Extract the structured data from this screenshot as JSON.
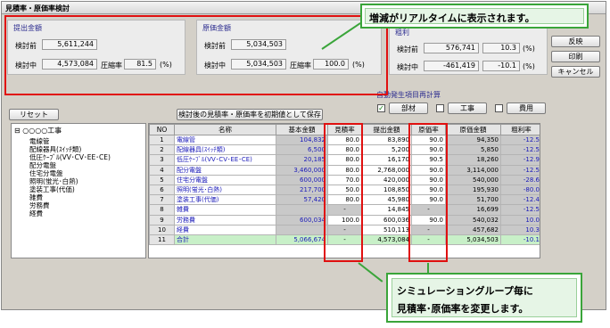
{
  "window": {
    "title": "見積率・原価率検討"
  },
  "submit_group": {
    "title": "提出金額",
    "before_label": "検討前",
    "before_value": "5,611,244",
    "during_label": "検討中",
    "during_value": "4,573,084",
    "ratio_label": "圧縮率",
    "ratio_value": "81.5",
    "unit": "(%)"
  },
  "cost_group": {
    "title": "原価金額",
    "before_label": "検討前",
    "before_value": "5,034,503",
    "during_label": "検討中",
    "during_value": "5,034,503",
    "ratio_label": "圧縮率",
    "ratio_value": "100.0",
    "unit": "(%)"
  },
  "profit_group": {
    "title": "粗利",
    "before_label": "検討前",
    "before_value": "576,741",
    "before_pct": "10.3",
    "during_label": "検討中",
    "during_value": "-461,419",
    "during_pct": "-10.1",
    "unit": "(%)"
  },
  "buttons": {
    "apply": "反映",
    "print": "印刷",
    "cancel": "キャンセル",
    "reset": "リセット",
    "save_initial": "検討後の見積率・原価率を初期値として保存"
  },
  "recalc": {
    "title": "自動発生項目再計算",
    "options": [
      {
        "label": "部材",
        "checked": true
      },
      {
        "label": "工事",
        "checked": false
      },
      {
        "label": "費用",
        "checked": false
      }
    ]
  },
  "tree": {
    "root": "○○○○工事",
    "nodes": [
      "電線管",
      "配線器具(ｽｲｯﾁ類)",
      "低圧ｹｰﾌﾞﾙ(VV･CV･EE･CE)",
      "配分電盤",
      "住宅分電盤",
      "照明(蛍光･白熱)",
      "塗装工事(代価)",
      "雑費",
      "労務費",
      "経費"
    ]
  },
  "table": {
    "columns": [
      "NO",
      "名称",
      "基本金額",
      "見積率",
      "提出金額",
      "原価率",
      "原価金額",
      "粗利率"
    ],
    "rows": [
      {
        "no": "1",
        "name": "電線管",
        "base": "104,832",
        "est_rate": "80.0",
        "submit": "83,890",
        "cost_rate": "90.0",
        "cost": "94,350",
        "margin": "-12.5"
      },
      {
        "no": "2",
        "name": "配線器具(ｽｲｯﾁ類)",
        "base": "6,500",
        "est_rate": "80.0",
        "submit": "5,200",
        "cost_rate": "90.0",
        "cost": "5,850",
        "margin": "-12.5"
      },
      {
        "no": "3",
        "name": "低圧ｹｰﾌﾞﾙ(VV･CV･EE･CE)",
        "base": "20,185",
        "est_rate": "80.0",
        "submit": "16,170",
        "cost_rate": "90.5",
        "cost": "18,260",
        "margin": "-12.9"
      },
      {
        "no": "4",
        "name": "配分電盤",
        "base": "3,460,000",
        "est_rate": "80.0",
        "submit": "2,768,000",
        "cost_rate": "90.0",
        "cost": "3,114,000",
        "margin": "-12.5"
      },
      {
        "no": "5",
        "name": "住宅分電盤",
        "base": "600,000",
        "est_rate": "70.0",
        "submit": "420,000",
        "cost_rate": "90.0",
        "cost": "540,000",
        "margin": "-28.6"
      },
      {
        "no": "6",
        "name": "照明(蛍光･白熱)",
        "base": "217,700",
        "est_rate": "50.0",
        "submit": "108,850",
        "cost_rate": "90.0",
        "cost": "195,930",
        "margin": "-80.0"
      },
      {
        "no": "7",
        "name": "塗装工事(代価)",
        "base": "57,420",
        "est_rate": "80.0",
        "submit": "45,980",
        "cost_rate": "90.0",
        "cost": "51,700",
        "margin": "-12.4"
      },
      {
        "no": "8",
        "name": "雑費",
        "base": "",
        "est_rate": "-",
        "submit": "14,845",
        "cost_rate": "-",
        "cost": "16,699",
        "margin": "-12.5"
      },
      {
        "no": "9",
        "name": "労務費",
        "base": "600,034",
        "est_rate": "100.0",
        "submit": "600,036",
        "cost_rate": "90.0",
        "cost": "540,032",
        "margin": "10.0"
      },
      {
        "no": "10",
        "name": "経費",
        "base": "",
        "est_rate": "-",
        "submit": "510,113",
        "cost_rate": "-",
        "cost": "457,682",
        "margin": "10.3"
      },
      {
        "no": "11",
        "name": "合計",
        "base": "5,066,674",
        "est_rate": "-",
        "submit": "4,573,084",
        "cost_rate": "-",
        "cost": "5,034,503",
        "margin": "-10.1"
      }
    ]
  },
  "annotations": {
    "top_callout": "増減がリアルタイムに表示されます。",
    "bottom_callout_line1": "シミュレーショングループ毎に",
    "bottom_callout_line2": "見積率･原価率を変更します。"
  },
  "colors": {
    "highlight_red": "#e01010",
    "callout_green": "#3aa53a",
    "name_blue": "#1a1ab8",
    "total_row_green": "#c8f0c8"
  }
}
